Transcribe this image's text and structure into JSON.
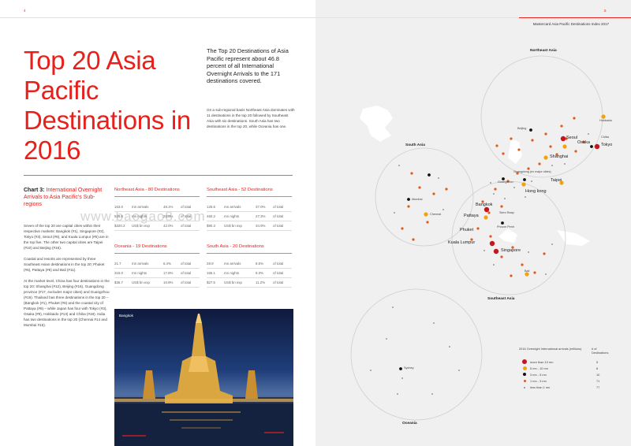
{
  "page_left": {
    "page_number": "4",
    "title": "Top 20 Asia Pacific Destinations in 2016",
    "intro_bold": "The Top 20 Destinations of Asia Pacific represent about 46.8 percent of all International Overnight Arrivals to the 171 destinations covered.",
    "intro_body": "On a sub-regional basis Northeast Asia dominates with 11 destinations in the top 20 followed by Southeast Asia with six destinations. South Asia has two destinations in the top 20, while Oceania has one.",
    "chart_heading_prefix": "Chart 3:",
    "chart_heading_rest": "International Overnight Arrivals to Asia Pacific's Sub-regions",
    "paragraphs": [
      "Seven of the top 20 are capital cities within their respective markets: Bangkok (#1), Singapore (#2), Tokyo (#3), Seoul (#6), and Kuala Lumpur (#5) are in the top five. The other two capital cities are Taipei (#10) and Beijing (#16).",
      "Coastal and resorts are represented by three Southeast Asian destinations in the top 20; Phuket (#6), Pattaya (#8) and Bali (#11).",
      "At the market level, China has four destinations in the top 20: Shanghai (#12), Beijing (#16), Guangdong province (#17, excludes major cities) and Guangzhou (#19). Thailand has three destinations in the top 20 – (Bangkok (#1), Phuket (#6) and the coastal city of Pattaya (#8) – while Japan has four with Tokyo (#3), Osaka (#9), Hokkaido (#13) and Chiba (#18). India has two destinations in the top 20 (Chennai #14 and Mumbai #15)."
    ],
    "photo_label": "Bangkok",
    "watermark": "www.baogao8.com"
  },
  "regions": [
    {
      "title": "Northeast Asia - 80 Destinations",
      "rows": [
        {
          "value": "163.0",
          "unit": "mn arrivals",
          "pct": "48.1%",
          "of": "of total"
        },
        {
          "value": "528.6",
          "unit": "mn nights",
          "pct": "28.5%",
          "of": "of total"
        },
        {
          "value": "$320.3",
          "unit": "US$ bn exp",
          "pct": "42.0%",
          "of": "of total"
        }
      ]
    },
    {
      "title": "Southeast Asia - 52 Destinations",
      "rows": [
        {
          "value": "125.6",
          "unit": "mn arrivals",
          "pct": "37.0%",
          "of": "of total"
        },
        {
          "value": "460.2",
          "unit": "mn nights",
          "pct": "27.3%",
          "of": "of total"
        },
        {
          "value": "$90.3",
          "unit": "US$ bn exp",
          "pct": "34.9%",
          "of": "of total"
        }
      ]
    },
    {
      "title": "Oceania - 19 Destinations",
      "rows": [
        {
          "value": "21.7",
          "unit": "mn arrivals",
          "pct": "6.4%",
          "of": "of total"
        },
        {
          "value": "315.0",
          "unit": "mn nights",
          "pct": "17.8%",
          "of": "of total"
        },
        {
          "value": "$36.7",
          "unit": "US$ bn exp",
          "pct": "10.9%",
          "of": "of total"
        }
      ]
    },
    {
      "title": "South Asia - 20 Destinations",
      "rows": [
        {
          "value": "28.9",
          "unit": "mn arrivals",
          "pct": "8.5%",
          "of": "of total"
        },
        {
          "value": "165.1",
          "unit": "mn nights",
          "pct": "9.3%",
          "of": "of total"
        },
        {
          "value": "$27.5",
          "unit": "US$ bn exp",
          "pct": "11.2%",
          "of": "of total"
        }
      ]
    }
  ],
  "page_right": {
    "page_number": "5",
    "header": "Mastercard Asia Pacific Destinations Index 2017",
    "region_labels": {
      "northeast_asia": "Northeast Asia",
      "south_asia": "South Asia",
      "southeast_asia": "Southeast Asia",
      "oceania": "Oceania"
    },
    "cities": {
      "seoul": "Seoul",
      "osaka": "Osaka",
      "tokyo": "Tokyo",
      "chiba": "Chiba",
      "hokkaido": "Hokkaido",
      "beijing": "Beijing",
      "shanghai": "Shanghai",
      "guangdong": "Guangdong (ex major cities)",
      "guangzhou": "Guangzhou",
      "taipei": "Taipei",
      "hong_kong": "Hong kong",
      "mumbai": "Mumbai",
      "chennai": "Chennai",
      "bangkok": "Bangkok",
      "pattaya": "Pattaya",
      "siem_reap": "Siem Reap",
      "phnom_penh": "Phnom Penh",
      "phuket": "Phuket",
      "kuala_lumpur": "Kuala Lumpur",
      "singapore": "Singapore",
      "bali": "Bali",
      "sydney": "Sydney"
    },
    "legend": {
      "heading_left": "2016 Overnight International arrivals (millions)",
      "heading_right": "# of Destinations",
      "rows": [
        {
          "label": "more than 10 mn",
          "count": "5",
          "color": "#c4161c"
        },
        {
          "label": "5 mn - 10 mn",
          "count": "8",
          "color": "#f0a30a"
        },
        {
          "label": "3 mn - 5 mn",
          "count": "10",
          "color": "#111111"
        },
        {
          "label": "1 mn - 3 mn",
          "count": "71",
          "color": "#e05a1a"
        },
        {
          "label": "less than 1 mn",
          "count": "77",
          "color": "#888888"
        }
      ]
    }
  }
}
